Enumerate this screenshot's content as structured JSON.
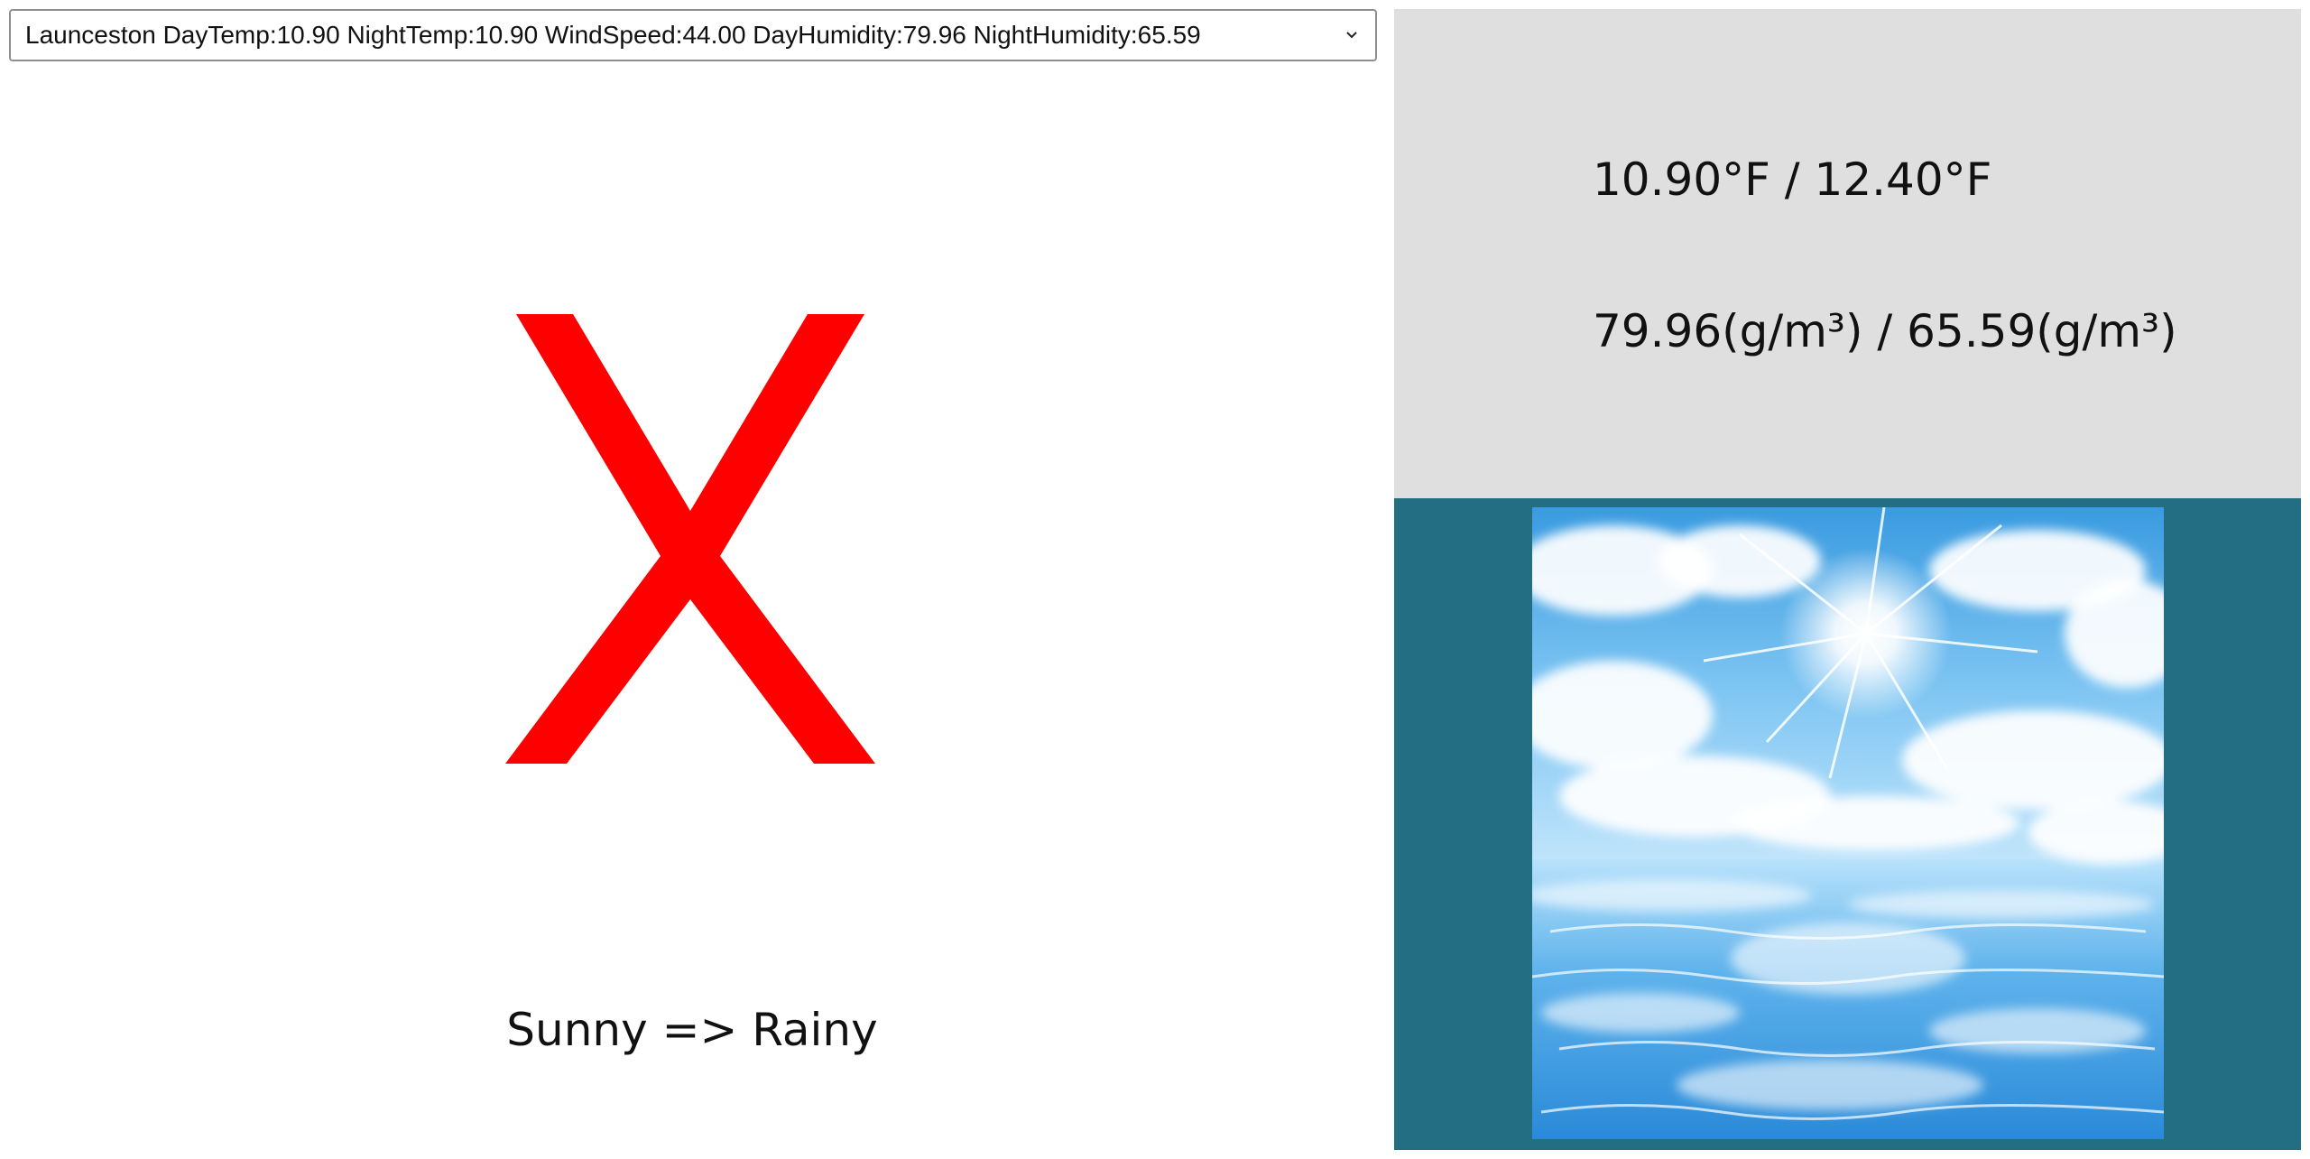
{
  "city_selector": {
    "selected": "Launceston DayTemp:10.90 NightTemp:10.90 WindSpeed:44.00 DayHumidity:79.96 NightHumidity:65.59"
  },
  "result": {
    "mark_icon": "red-x-icon",
    "mark_color": "#ff0000",
    "transition_text": "Sunny => Rainy"
  },
  "info": {
    "temperature_text": "10.90°F / 12.40°F",
    "humidity_text": "79.96(g/m³) / 65.59(g/m³)"
  },
  "image": {
    "description_icon": "sunny-sky-over-water-image"
  },
  "colors": {
    "info_panel_bg": "#dfdfdf",
    "image_panel_bg": "#236e82",
    "x_mark": "#ff0000"
  }
}
